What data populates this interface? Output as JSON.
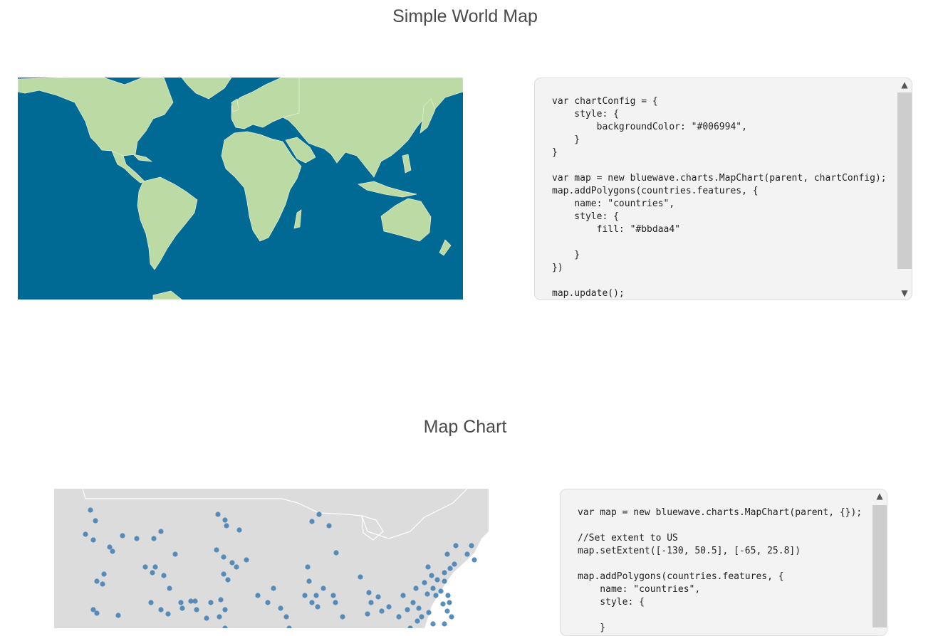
{
  "sections": [
    {
      "title": "Simple World Map",
      "map": {
        "background_color": "#006994",
        "land_color": "#bbdaa4",
        "border_color": "#e6f0da"
      },
      "code": "var chartConfig = {\n    style: {\n        backgroundColor: \"#006994\",\n    }\n}\n\nvar map = new bluewave.charts.MapChart(parent, chartConfig);\nmap.addPolygons(countries.features, {\n    name: \"countries\",\n    style: {\n        fill: \"#bbdaa4\"\n\n    }\n})\n\nmap.update();"
    },
    {
      "title": "Map Chart",
      "map": {
        "background_color": "#ffffff",
        "land_color": "#dcdcdc",
        "border_color": "#ffffff",
        "point_color": "#4682b4"
      },
      "code": "var map = new bluewave.charts.MapChart(parent, {});\n\n//Set extent to US\nmap.setExtent([-130, 50.5], [-65, 25.8])\n\nmap.addPolygons(countries.features, {\n    name: \"countries\",\n    style: {\n\n    }"
    }
  ],
  "scrollbar": {
    "up_icon": "chevron-up-icon",
    "down_icon": "chevron-down-icon"
  }
}
